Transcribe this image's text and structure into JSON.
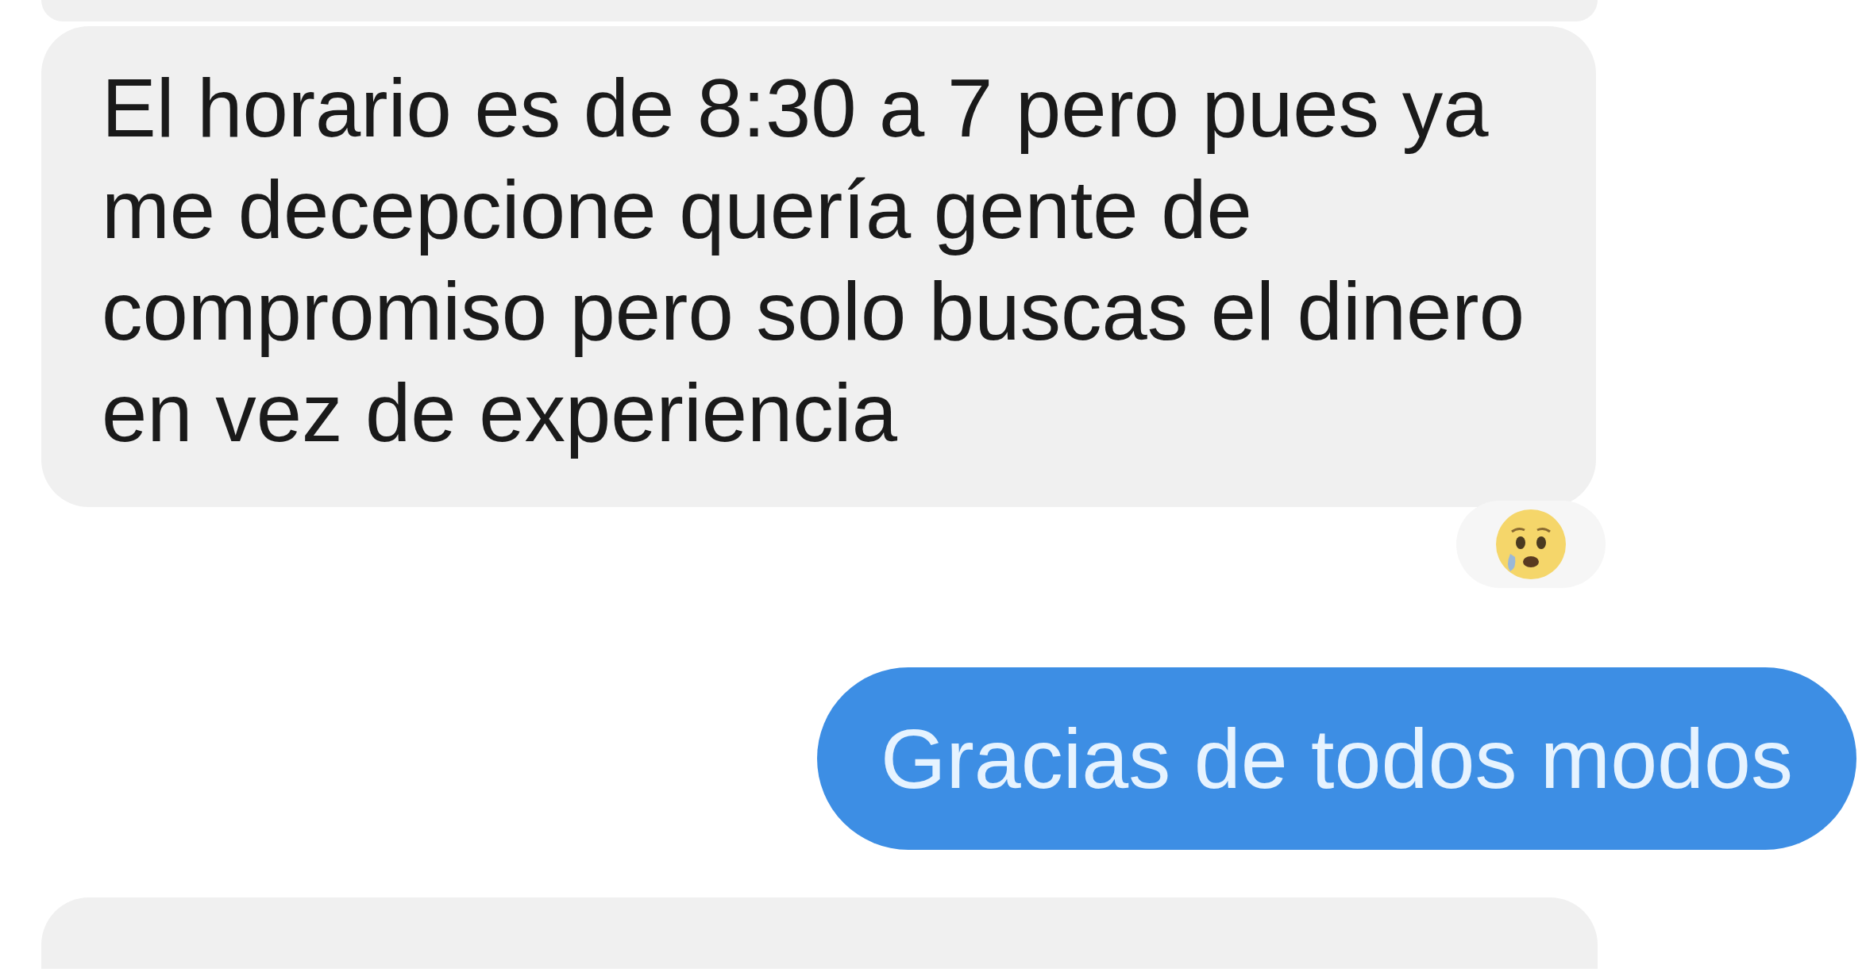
{
  "messages": [
    {
      "kind": "fragment"
    },
    {
      "kind": "incoming",
      "text": "El horario es de 8:30 a 7 pero pues ya me decepcione quería gente de compromiso pero solo buscas el dinero en vez de experiencia",
      "reacted": true
    },
    {
      "kind": "outgoing",
      "text": "Gracias de todos modos"
    },
    {
      "kind": "fragment"
    }
  ]
}
